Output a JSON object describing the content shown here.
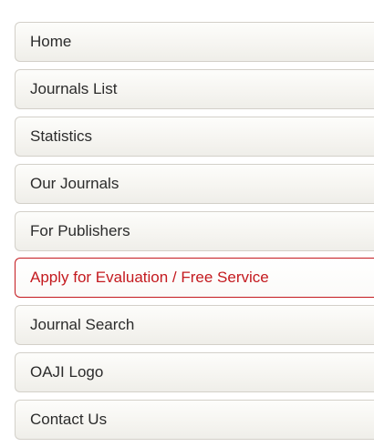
{
  "nav": {
    "items": [
      {
        "label": "Home"
      },
      {
        "label": "Journals List"
      },
      {
        "label": "Statistics"
      },
      {
        "label": "Our Journals"
      },
      {
        "label": "For Publishers"
      },
      {
        "label": "Apply for Evaluation / Free Service"
      },
      {
        "label": "Journal Search"
      },
      {
        "label": "OAJI Logo"
      },
      {
        "label": "Contact Us"
      }
    ],
    "highlight_color": "#c41a1f",
    "text_color": "#2b2b2b",
    "border_color": "#d3d0c9"
  }
}
